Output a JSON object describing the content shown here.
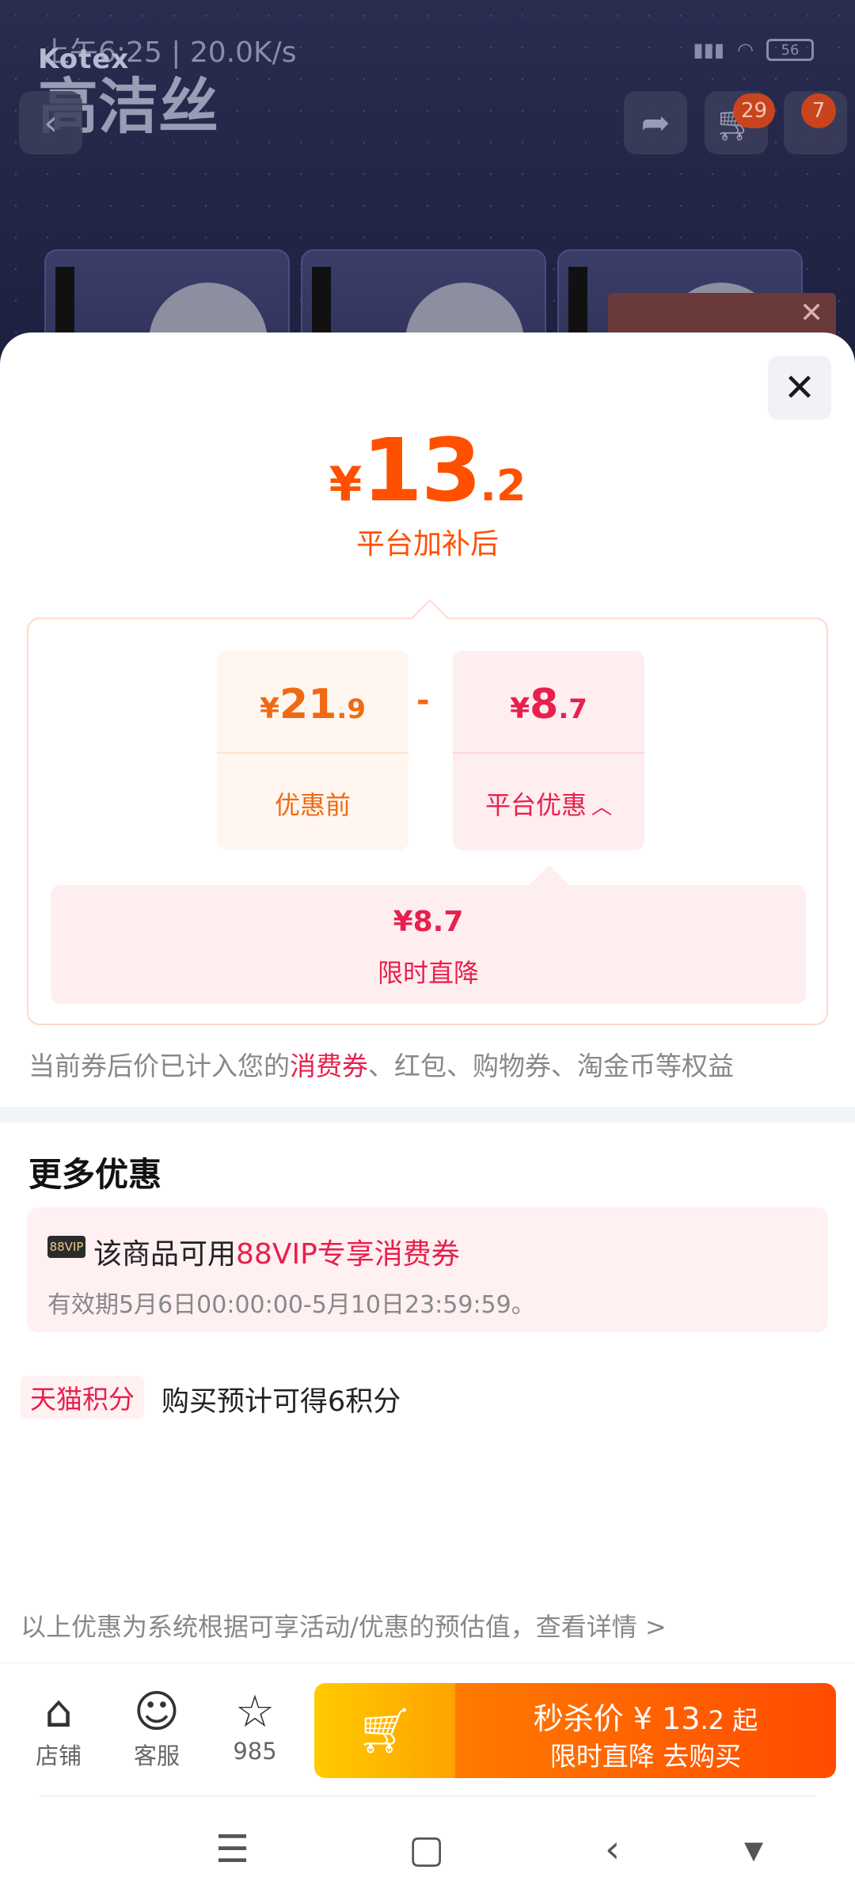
{
  "status_bar": {
    "time": "上午6:25 | 20.0K/s",
    "battery": "56"
  },
  "brand": {
    "en": "Kotex",
    "cn": "高洁丝"
  },
  "header": {
    "cart_count": "29",
    "message_count": "7"
  },
  "summary": {
    "currency": "¥",
    "price_int": "13",
    "price_dec": ".2",
    "label": "平台加补后"
  },
  "breakdown": {
    "before": {
      "currency": "¥",
      "int": "21",
      "dec": ".9",
      "label": "优惠前"
    },
    "minus": "-",
    "platform": {
      "currency": "¥",
      "int": "8",
      "dec": ".7",
      "label": "平台优惠"
    },
    "detail": {
      "value": "¥8.7",
      "label": "限时直降"
    }
  },
  "note": {
    "prefix": "当前券后价已计入您的",
    "highlight": "消费券",
    "suffix": "、红包、购物券、淘金币等权益"
  },
  "more": {
    "title": "更多优惠",
    "vip": {
      "tag": "88VIP",
      "prefix": "该商品可用",
      "highlight": "88VIP专享消费券",
      "validity": "有效期5月6日00:00:00-5月10日23:59:59。"
    },
    "points": {
      "tag": "天猫积分",
      "text": "购买预计可得6积分"
    }
  },
  "disclaimer": "以上优惠为系统根据可享活动/优惠的预估值，查看详情 >",
  "actions": {
    "store": "店铺",
    "service": "客服",
    "favorites": "985",
    "buy_line1_prefix": "秒杀价 ¥ 13",
    "buy_line1_dec": ".2",
    "buy_line1_suffix": " 起",
    "buy_line2": "限时直降  去购买"
  },
  "colors": {
    "accent": "#ff5000",
    "red": "#e8204c"
  }
}
